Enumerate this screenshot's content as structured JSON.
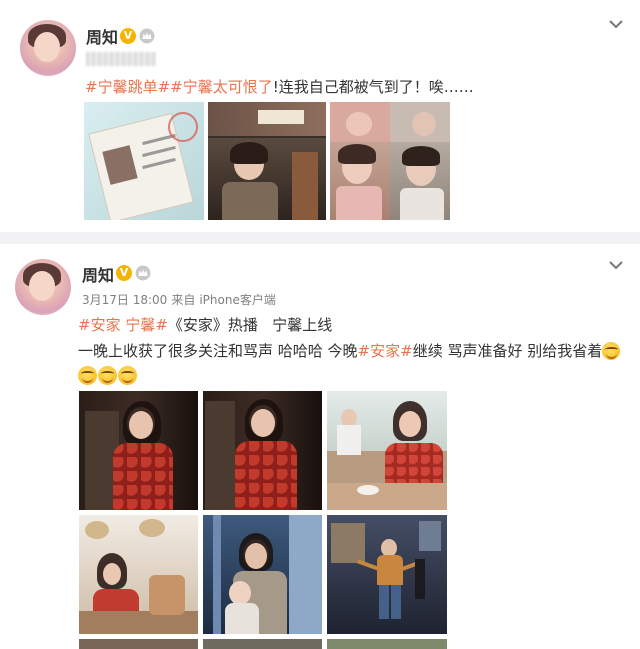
{
  "post1": {
    "username": "周知",
    "verified_badge": "V",
    "text": {
      "tag1": "#宁馨跳单#",
      "tag2": "#宁馨太可恨了",
      "body": "!连我自己都被气到了！唉……"
    }
  },
  "post2": {
    "username": "周知",
    "verified_badge": "V",
    "meta": {
      "date": "3月17日 18:00",
      "source_prefix": "来自",
      "source": "iPhone客户端"
    },
    "line1": {
      "tag1": "#安家 宁馨#",
      "title": "《安家》热播",
      "tail": "   宁馨上线"
    },
    "line2": {
      "part1": "一晚上收获了很多关注和骂声 哈哈哈 今晚",
      "tag": "#安家#",
      "part2": "继续 骂声准备好 别给我省着"
    }
  },
  "icons": {
    "chevron": "chevron-down-icon",
    "crown": "crown-icon",
    "emoji": "grin-emoji-icon"
  },
  "colors": {
    "tag": "#eb7350",
    "text": "#333333",
    "meta": "#808080",
    "separator": "#f2f2f5",
    "verified": "#f5b400"
  }
}
